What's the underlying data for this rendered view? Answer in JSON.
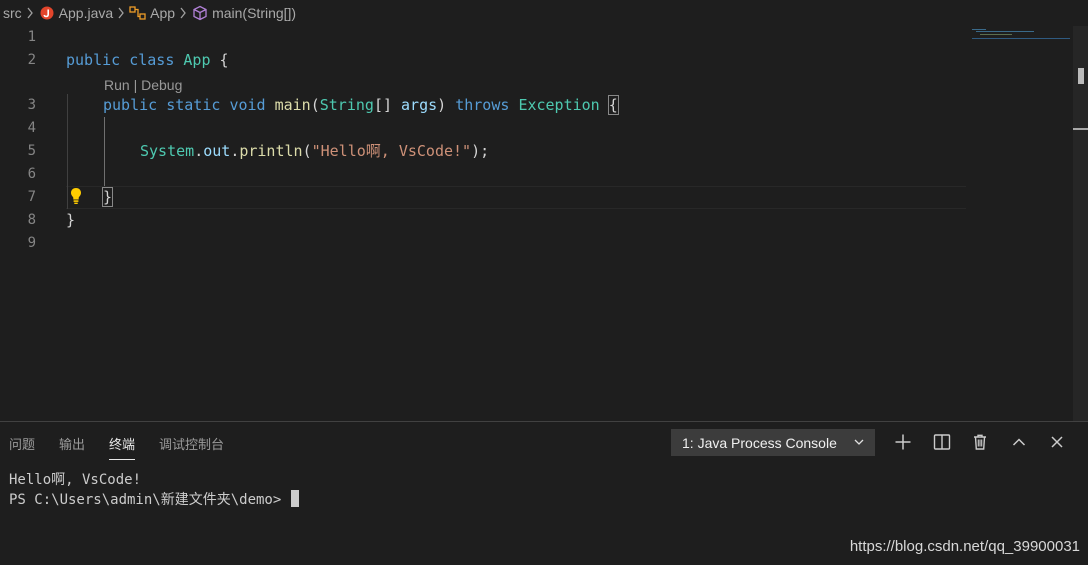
{
  "breadcrumb": {
    "folder": "src",
    "file": "App.java",
    "class": "App",
    "method": "main(String[])"
  },
  "editor": {
    "line_numbers": [
      "1",
      "2",
      "3",
      "4",
      "5",
      "6",
      "7",
      "8",
      "9"
    ],
    "codelens": {
      "run": "Run",
      "sep": " | ",
      "debug": "Debug"
    },
    "line2": {
      "kw1": "public",
      "kw2": "class",
      "name": "App",
      "brace": "{"
    },
    "line3": {
      "kw1": "public",
      "kw2": "static",
      "kw3": "void",
      "fn": "main",
      "open": "(",
      "type": "String",
      "arr": "[]",
      "param": "args",
      "close": ")",
      "throws": "throws",
      "exc": "Exception",
      "brace": "{"
    },
    "line5": {
      "obj": "System",
      "dot1": ".",
      "field": "out",
      "dot2": ".",
      "fn": "println",
      "open": "(",
      "str": "\"Hello啊, VsCode!\"",
      "close": ");"
    },
    "line7": {
      "brace": "}"
    },
    "line8": {
      "brace": "}"
    }
  },
  "panel": {
    "tabs": [
      "问题",
      "输出",
      "终端",
      "调试控制台"
    ],
    "active_tab": "终端",
    "console_select": "1: Java Process Console",
    "terminal_lines": [
      "Hello啊, VsCode!",
      "PS C:\\Users\\admin\\新建文件夹\\demo> "
    ]
  },
  "watermark": "https://blog.csdn.net/qq_39900031",
  "colors": {
    "background": "#1e1e1e",
    "keyword": "#569cd6",
    "type": "#4ec9b0",
    "function": "#dcdcaa",
    "parameter": "#9cdcfe",
    "string": "#ce9178",
    "java_icon": "#e2452b",
    "lightbulb": "#ffcc00"
  },
  "icons": [
    "chevron-right-icon",
    "java-file-icon",
    "class-icon",
    "method-cube-icon",
    "lightbulb-icon",
    "plus-icon",
    "split-icon",
    "trash-icon",
    "chevron-up-icon",
    "close-icon",
    "chevron-down-icon"
  ]
}
